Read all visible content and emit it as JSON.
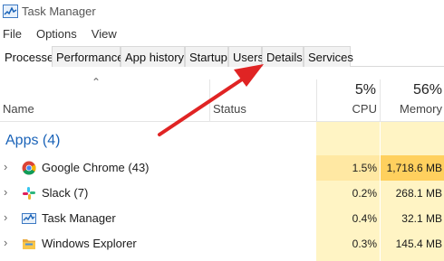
{
  "window": {
    "title": "Task Manager"
  },
  "menu": [
    "File",
    "Options",
    "View"
  ],
  "tabs": [
    "Processes",
    "Performance",
    "App history",
    "Startup",
    "Users",
    "Details",
    "Services"
  ],
  "active_tab": "Processes",
  "columns": {
    "name": "Name",
    "status": "Status",
    "cpu_percent": "5%",
    "cpu": "CPU",
    "memory_percent": "56%",
    "memory": "Memory"
  },
  "group": {
    "label": "Apps (4)"
  },
  "processes": [
    {
      "name": "Google Chrome (43)",
      "cpu": "1.5%",
      "memory": "1,718.6 MB",
      "icon": "chrome-icon"
    },
    {
      "name": "Slack (7)",
      "cpu": "0.2%",
      "memory": "268.1 MB",
      "icon": "slack-icon"
    },
    {
      "name": "Task Manager",
      "cpu": "0.4%",
      "memory": "32.1 MB",
      "icon": "task-manager-icon"
    },
    {
      "name": "Windows Explorer",
      "cpu": "0.3%",
      "memory": "145.4 MB",
      "icon": "folder-icon"
    }
  ],
  "colors": {
    "accent": "#1a63b8",
    "heat_light": "#fff4c4",
    "heat_medium": "#ffe8a3",
    "heat_strong": "#ffd05e",
    "annotation_arrow": "#e02424"
  }
}
